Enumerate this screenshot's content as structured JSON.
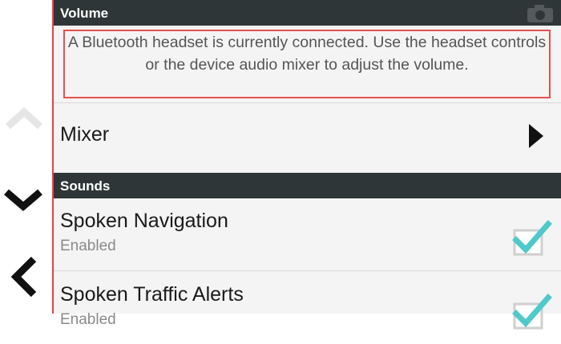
{
  "volume_section": {
    "header": "Volume",
    "message": "A Bluetooth headset is currently connected. Use the headset controls or the device audio mixer to adjust the volume."
  },
  "mixer": {
    "label": "Mixer"
  },
  "sounds_section": {
    "header": "Sounds",
    "items": [
      {
        "title": "Spoken Navigation",
        "subtitle": "Enabled",
        "checked": true
      },
      {
        "title": "Spoken Traffic Alerts",
        "subtitle": "Enabled",
        "checked": true
      }
    ]
  },
  "nav_rail": {
    "icons": [
      "chevron-up-icon",
      "chevron-down-icon",
      "back-arrow-icon"
    ]
  },
  "colors": {
    "header_bg": "#2f3637",
    "checkmark": "#4fc9c9",
    "highlight_border": "#e55050"
  }
}
